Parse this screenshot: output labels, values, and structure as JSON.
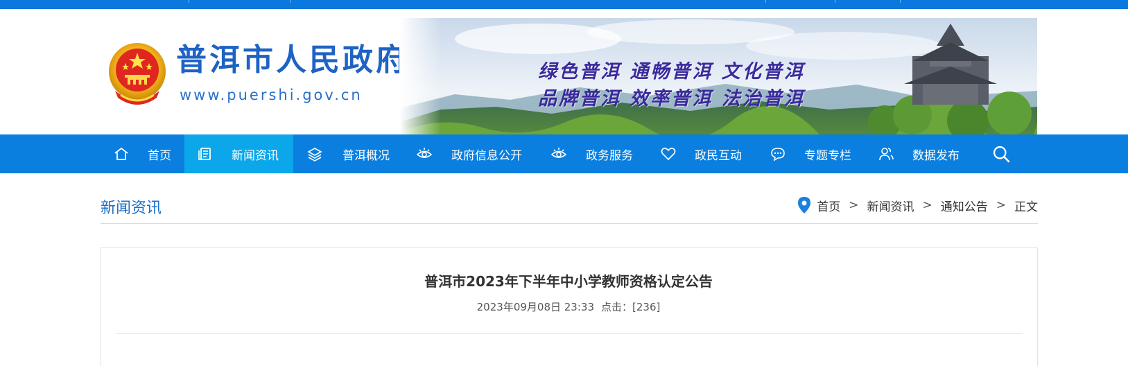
{
  "header": {
    "site_title": "普洱市人民政府",
    "site_url": "www.puershi.gov.cn",
    "slogan_line1": "绿色普洱  通畅普洱  文化普洱",
    "slogan_line2": "品牌普洱  效率普洱  法治普洱"
  },
  "nav": {
    "items": [
      {
        "label": "首页",
        "icon": "home-icon"
      },
      {
        "label": "新闻资讯",
        "icon": "news-icon",
        "active": true
      },
      {
        "label": "普洱概况",
        "icon": "layers-icon"
      },
      {
        "label": "政府信息公开",
        "icon": "eye-icon"
      },
      {
        "label": "政务服务",
        "icon": "eye-icon"
      },
      {
        "label": "政民互动",
        "icon": "heart-icon"
      },
      {
        "label": "专题专栏",
        "icon": "chat-icon"
      },
      {
        "label": "数据发布",
        "icon": "users-icon"
      }
    ],
    "search_icon": "search-icon"
  },
  "section": {
    "title": "新闻资讯"
  },
  "breadcrumb": {
    "icon": "location-pin-icon",
    "items": [
      "首页",
      "新闻资讯",
      "通知公告",
      "正文"
    ],
    "separator": ">"
  },
  "article": {
    "title": "普洱市2023年下半年中小学教师资格认定公告",
    "date": "2023年09月08日 23:33",
    "clicks_label": "点击：",
    "clicks_value": "[236]"
  },
  "colors": {
    "nav_bg": "#0a7fe0",
    "nav_active_bg": "#0ba7ea",
    "brand_blue": "#1e63c4",
    "slogan_purple": "#3a2a9c"
  }
}
